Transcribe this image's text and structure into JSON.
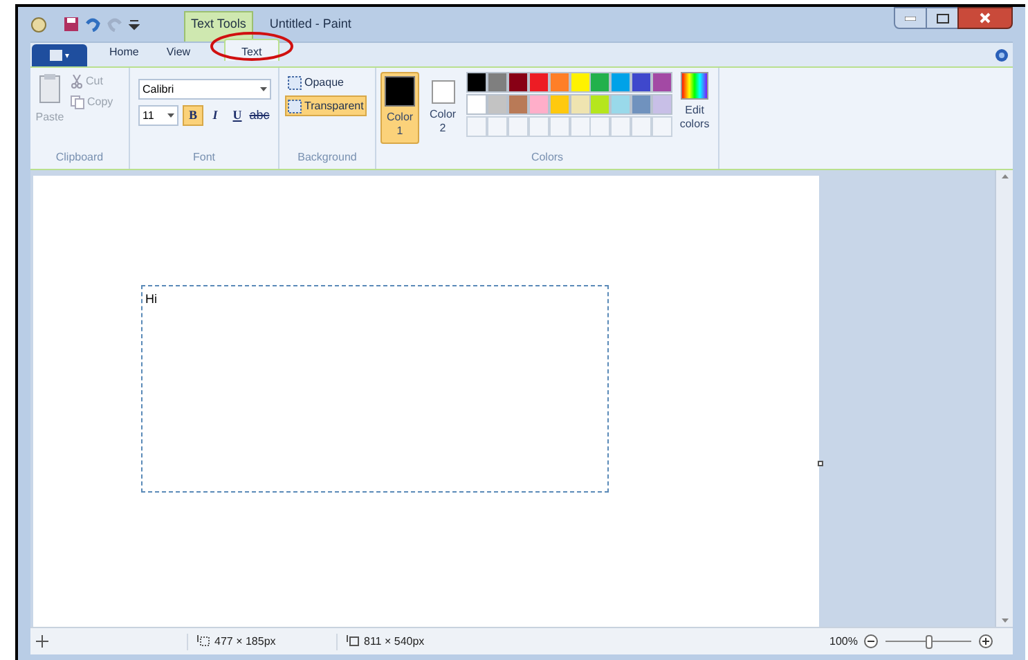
{
  "window": {
    "title": "Untitled - Paint",
    "context_tab": "Text Tools"
  },
  "tabs": [
    {
      "label": "Home",
      "selected": false
    },
    {
      "label": "View",
      "selected": false
    },
    {
      "label": "Text",
      "selected": true
    }
  ],
  "clipboard": {
    "paste": "Paste",
    "cut": "Cut",
    "copy": "Copy",
    "label": "Clipboard"
  },
  "font": {
    "family": "Calibri",
    "size": "11",
    "styles": [
      {
        "label": "B",
        "kind": "bold",
        "on": true
      },
      {
        "label": "I",
        "kind": "italic",
        "on": false
      },
      {
        "label": "U",
        "kind": "underline",
        "on": false
      },
      {
        "label": "abc",
        "kind": "strike",
        "on": false
      }
    ],
    "label": "Font"
  },
  "background": {
    "options": [
      {
        "label": "Opaque",
        "selected": false
      },
      {
        "label": "Transparent",
        "selected": true
      }
    ],
    "label": "Background"
  },
  "colors": {
    "slots": [
      {
        "label": "Color",
        "number": "1",
        "color": "#000000",
        "selected": true
      },
      {
        "label": "Color",
        "number": "2",
        "color": "#ffffff",
        "selected": false
      }
    ],
    "palette": [
      {
        "color": "#000000"
      },
      {
        "color": "#7f7f7f"
      },
      {
        "color": "#880015"
      },
      {
        "color": "#ed1c24"
      },
      {
        "color": "#ff7f27"
      },
      {
        "color": "#fff200"
      },
      {
        "color": "#22b14c"
      },
      {
        "color": "#00a2e8"
      },
      {
        "color": "#3f48cc"
      },
      {
        "color": "#a349a4"
      },
      {
        "color": "#ffffff"
      },
      {
        "color": "#c3c3c3"
      },
      {
        "color": "#b97a57"
      },
      {
        "color": "#ffaec9"
      },
      {
        "color": "#ffc90e"
      },
      {
        "color": "#efe4b0"
      },
      {
        "color": "#b5e61d"
      },
      {
        "color": "#99d9ea"
      },
      {
        "color": "#7092be"
      },
      {
        "color": "#c8bfe7"
      }
    ],
    "edit": "Edit colors",
    "label": "Colors"
  },
  "canvas": {
    "text": "Hi"
  },
  "status_bar": {
    "selection": "477 × 185px",
    "size": "811 × 540px",
    "zoom": "100%",
    "zoom_slider": {
      "level": 0.5
    }
  }
}
